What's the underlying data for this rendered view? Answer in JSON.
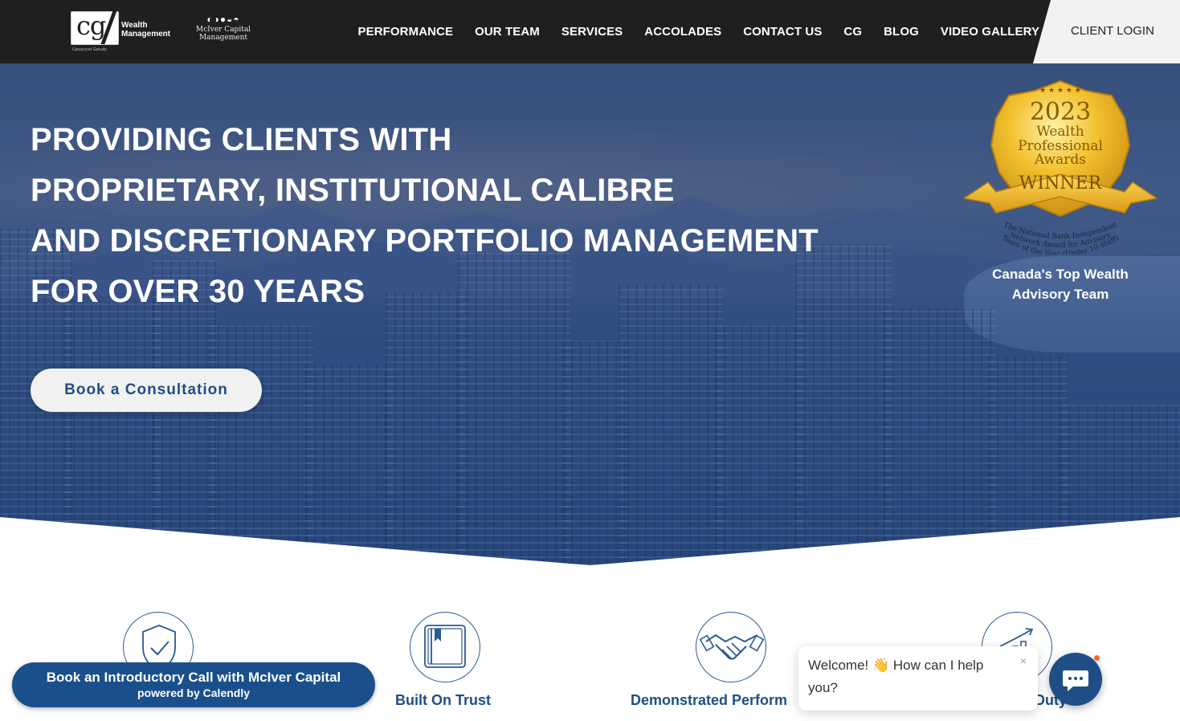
{
  "brand": {
    "cg_logo_text": "cg",
    "wealth_line1": "Wealth",
    "wealth_line2": "Management",
    "cg_subtext": "Canaccord Genuity",
    "mciver_line1": "McIver Capital",
    "mciver_line2": "Management"
  },
  "nav": {
    "items": [
      {
        "label": "PERFORMANCE"
      },
      {
        "label": "OUR TEAM"
      },
      {
        "label": "SERVICES"
      },
      {
        "label": "ACCOLADES"
      },
      {
        "label": "CONTACT US"
      },
      {
        "label": "CG"
      },
      {
        "label": "BLOG"
      },
      {
        "label": "VIDEO GALLERY"
      }
    ],
    "client_login": "CLIENT LOGIN"
  },
  "hero": {
    "headline_lines": [
      "PROVIDING CLIENTS WITH",
      "PROPRIETARY, INSTITUTIONAL CALIBRE",
      "AND DISCRETIONARY PORTFOLIO MANAGEMENT",
      "FOR OVER 30 YEARS"
    ],
    "cta_label": "Book a Consultation"
  },
  "award": {
    "year": "2023",
    "line1": "Wealth",
    "line2": "Professional",
    "line3": "Awards",
    "ribbon": "WINNER",
    "arc_line1": "The National Bank Independent",
    "arc_line2": "Network Award for Advisory",
    "arc_line3": "Team of the Year (Under 10 Staff)",
    "caption_line1": "Canada's Top Wealth",
    "caption_line2": "Advisory Team"
  },
  "features": [
    {
      "label": "",
      "icon": "shield-check-icon"
    },
    {
      "label": "Built On Trust",
      "icon": "book-icon"
    },
    {
      "label": "Demonstrated Perform",
      "icon": "handshake-icon"
    },
    {
      "label": "Duty",
      "icon": "growth-chart-icon"
    }
  ],
  "calendly": {
    "main": "Book an Introductory Call with McIver Capital",
    "sub": "powered by Calendly"
  },
  "chat": {
    "message_start": "Welcome! ",
    "wave_emoji": "👋",
    "message_end": " How can I help you?",
    "close": "×"
  },
  "colors": {
    "navbar": "#1f1f1f",
    "accent": "#1f4e86",
    "calendly": "#1a4f8c",
    "notification_dot": "#f06a2c",
    "award_gold": "#f2c230"
  }
}
